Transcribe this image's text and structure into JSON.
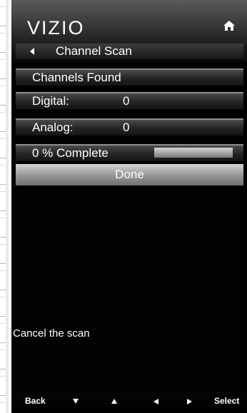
{
  "brand": "VIZIO",
  "header_icon": "home-icon",
  "menu": {
    "title": "Channel Scan",
    "channels_found": "Channels Found",
    "digital_label": "Digital:",
    "digital_value": "0",
    "analog_label": "Analog:",
    "analog_value": "0",
    "progress_text": "0 % Complete",
    "progress_fraction": 0,
    "done_label": "Done"
  },
  "help_text": "Cancel the scan",
  "softkeys": {
    "back": "Back",
    "select": "Select",
    "down_icon": "down-arrow-icon",
    "up_icon": "up-arrow-icon",
    "left_icon": "left-arrow-icon",
    "right_icon": "right-arrow-icon"
  },
  "colors": {
    "background": "#020202",
    "text": "#ffffff",
    "button_gray": "#9f9f9f"
  }
}
